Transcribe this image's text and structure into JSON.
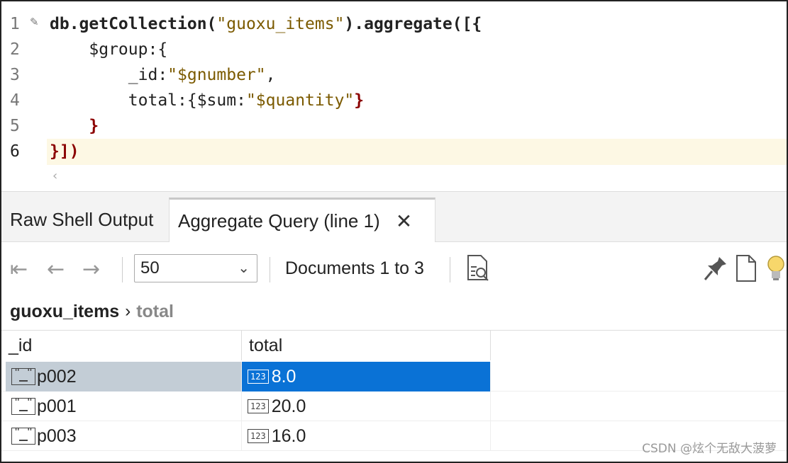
{
  "editor": {
    "line_numbers": [
      "1",
      "2",
      "3",
      "4",
      "5",
      "6"
    ],
    "lines": [
      [
        "db.getCollection(",
        "\"guoxu_items\"",
        ").aggregate([{"
      ],
      [
        "    $group:{"
      ],
      [
        "        _id:",
        "\"$gnumber\"",
        ","
      ],
      [
        "        total:{$sum:",
        "\"$quantity\"",
        "}"
      ],
      [
        "    }"
      ],
      [
        "}])"
      ]
    ]
  },
  "tabs": {
    "raw": "Raw Shell Output",
    "active": "Aggregate Query (line 1)",
    "close": "✕"
  },
  "toolbar": {
    "page_size": "50",
    "doc_range": "Documents 1 to 3"
  },
  "breadcrumb": {
    "collection": "guoxu_items",
    "field": "total"
  },
  "table": {
    "columns": [
      "_id",
      "total"
    ],
    "rows": [
      {
        "id": "p002",
        "total": "8.0"
      },
      {
        "id": "p001",
        "total": "20.0"
      },
      {
        "id": "p003",
        "total": "16.0"
      }
    ]
  },
  "icons": {
    "number_type": "123"
  },
  "watermark": "CSDN @炫个无敌大菠萝",
  "colors": {
    "selected_cell": "#0a72d6",
    "selected_row": "#c3cdd6"
  }
}
